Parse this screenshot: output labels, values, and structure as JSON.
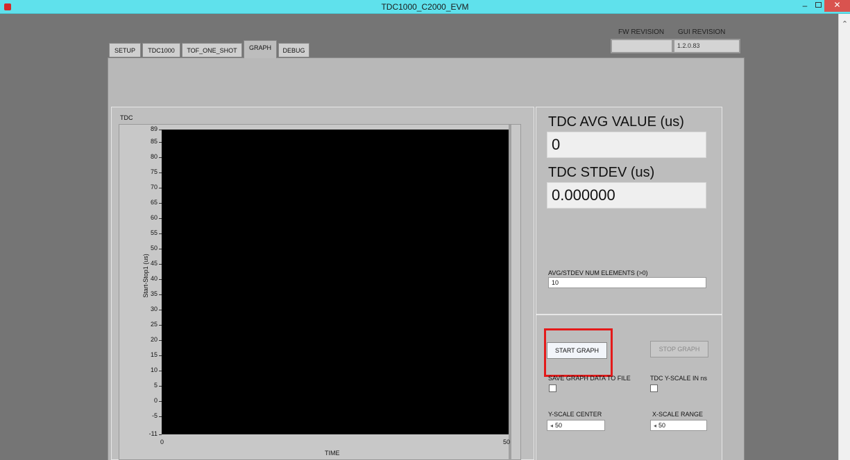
{
  "window": {
    "title": "TDC1000_C2000_EVM",
    "minimize": "–",
    "close": "✕"
  },
  "header": {
    "fw_revision_label": "FW REVISION",
    "fw_revision_value": "",
    "gui_revision_label": "GUI REVISION",
    "gui_revision_value": "1.2.0.83"
  },
  "tabs": [
    {
      "label": "SETUP"
    },
    {
      "label": "TDC1000"
    },
    {
      "label": "TOF_ONE_SHOT"
    },
    {
      "label": "GRAPH",
      "active": true
    },
    {
      "label": "DEBUG"
    }
  ],
  "graph": {
    "title": "TDC",
    "y_axis_label": "Start-Stop1 (us)",
    "x_axis_label": "TIME",
    "y_ticks": [
      "89",
      "85",
      "80",
      "75",
      "70",
      "65",
      "60",
      "55",
      "50",
      "45",
      "40",
      "35",
      "30",
      "25",
      "20",
      "15",
      "10",
      "5",
      "0",
      "-5",
      "-11"
    ],
    "x_ticks": [
      "0",
      "50"
    ]
  },
  "stats": {
    "avg_label": "TDC AVG VALUE (us)",
    "avg_value": "0",
    "stdev_label": "TDC STDEV (us)",
    "stdev_value": "0.000000",
    "num_elements_label": "AVG/STDEV NUM ELEMENTS (>0)",
    "num_elements_value": "10"
  },
  "controls": {
    "start_graph_label": "START GRAPH",
    "stop_graph_label": "STOP GRAPH",
    "save_graph_label": "SAVE GRAPH DATA TO FILE",
    "y_scale_ns_label": "TDC Y-SCALE IN ns",
    "y_scale_center_label": "Y-SCALE CENTER",
    "y_scale_center_value": "50",
    "x_scale_range_label": "X-SCALE RANGE",
    "x_scale_range_value": "50"
  },
  "colors": {
    "titlebar": "#5fe1ec",
    "highlight": "#e41a1a",
    "plot_background": "#000000"
  },
  "icons": {
    "app": "app-icon",
    "scroll_up": "chevron-up-icon"
  }
}
